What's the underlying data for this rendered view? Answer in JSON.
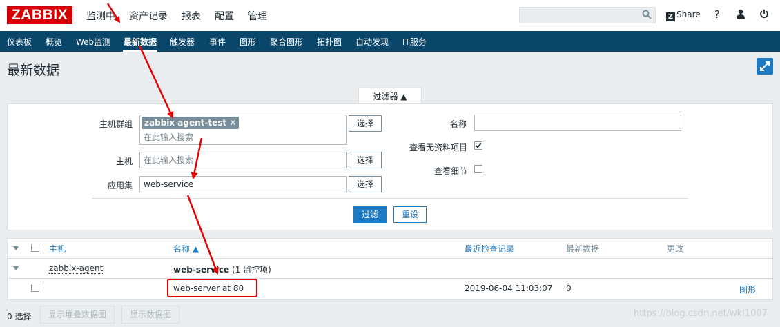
{
  "app": {
    "logo": "ZABBIX"
  },
  "top_menu": {
    "items": [
      "监测中",
      "资产记录",
      "报表",
      "配置",
      "管理"
    ],
    "share": "Share",
    "help": "?"
  },
  "nav": {
    "items": [
      "仪表板",
      "概览",
      "Web监测",
      "最新数据",
      "触发器",
      "事件",
      "图形",
      "聚合图形",
      "拓扑图",
      "自动发现",
      "IT服务"
    ],
    "active": "最新数据"
  },
  "page": {
    "title": "最新数据"
  },
  "filter": {
    "tab_label": "过滤器 ▲",
    "host_group": {
      "label": "主机群组",
      "tag": "zabbix agent-test",
      "placeholder": "在此输入搜索",
      "select": "选择"
    },
    "host": {
      "label": "主机",
      "placeholder": "在此输入搜索",
      "select": "选择"
    },
    "application": {
      "label": "应用集",
      "value": "web-service",
      "select": "选择"
    },
    "name": {
      "label": "名称",
      "value": ""
    },
    "show_no_data": {
      "label": "查看无资料项目",
      "checked": true
    },
    "show_details": {
      "label": "查看细节",
      "checked": false
    },
    "apply": "过滤",
    "reset": "重设"
  },
  "table": {
    "headers": {
      "host": "主机",
      "name": "名称 ▲",
      "last_check": "最近检查记录",
      "last_value": "最新数据",
      "change": "更改"
    },
    "group_row": {
      "host": "zabbix-agent",
      "app_name": "web-service",
      "app_count": "(1 监控项)"
    },
    "item_row": {
      "name": "web-server at 80",
      "last_check": "2019-06-04 11:03:07",
      "last_value": "0",
      "action": "图形"
    }
  },
  "footer": {
    "selected": "0 选择",
    "stacked_graph": "显示堆叠数据图",
    "graph": "显示数据图"
  },
  "watermark": "https://blog.csdn.net/wkl1007",
  "colors": {
    "brand": "#d40000",
    "nav": "#0a466a",
    "link": "#1f7ac2",
    "annotation": "#e30000"
  }
}
